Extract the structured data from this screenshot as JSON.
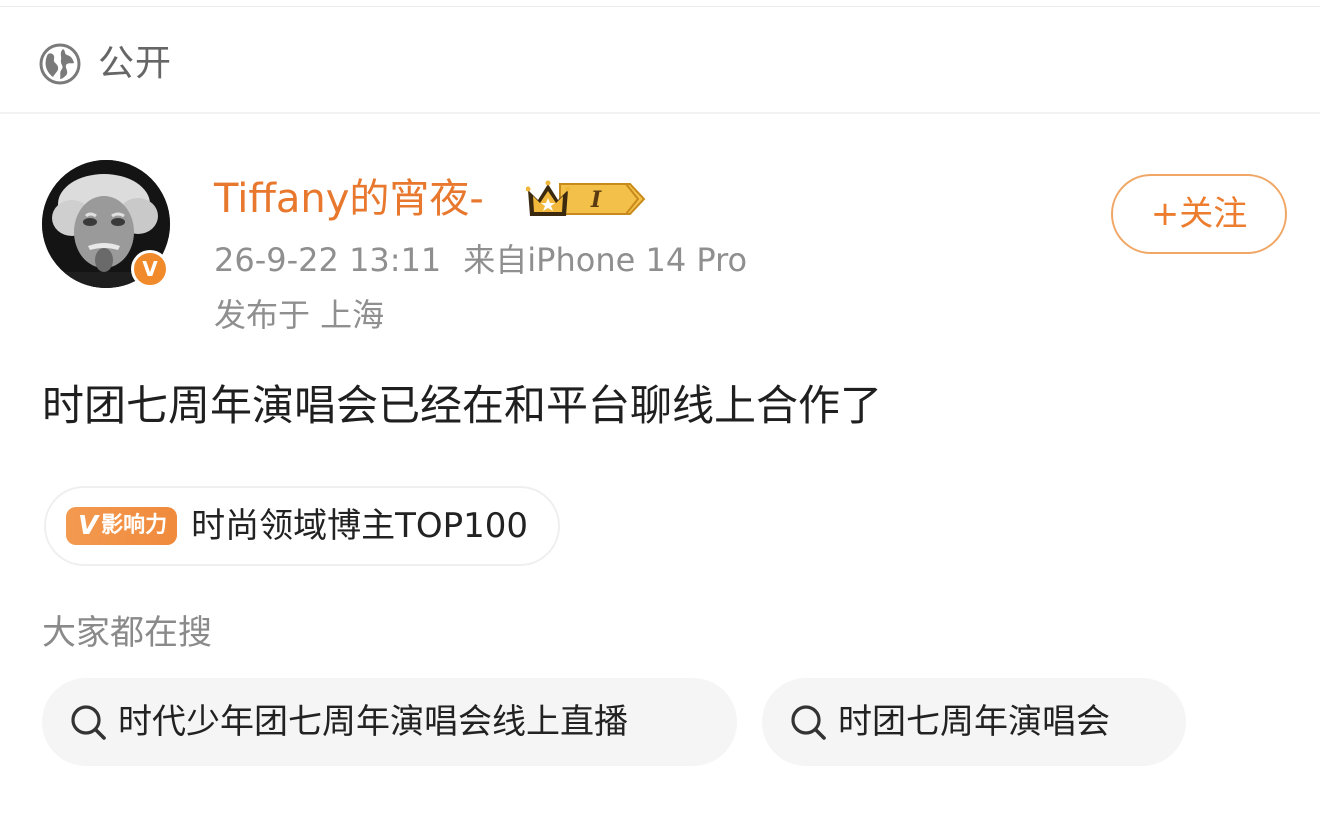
{
  "visibility": {
    "icon": "globe-icon",
    "label": "公开"
  },
  "author": {
    "name": "Tiffany的宵夜-",
    "avatar_icon": "avatar",
    "verified_icon": "verified-v-icon",
    "verified_mark": "V",
    "member_badge": {
      "icon": "crown-icon",
      "level": "I"
    },
    "follow_label": "+关注"
  },
  "post": {
    "timestamp": "26-9-22 13:11",
    "source": "来自iPhone 14 Pro",
    "location": "发布于 上海",
    "text": "时团七周年演唱会已经在和平台聊线上合作了"
  },
  "influence": {
    "tag_mark": "V",
    "tag_label": "影响力",
    "text": "时尚领域博主TOP100"
  },
  "search": {
    "heading": "大家都在搜",
    "items": [
      {
        "icon": "search-icon",
        "label": "时代少年团七周年演唱会线上直播"
      },
      {
        "icon": "search-icon",
        "label": "时团七周年演唱会"
      }
    ]
  },
  "colors": {
    "accent": "#e8782e",
    "follow_border": "#f0a766",
    "meta_text": "#8f8f8f",
    "pill_bg": "#f5f5f5"
  }
}
